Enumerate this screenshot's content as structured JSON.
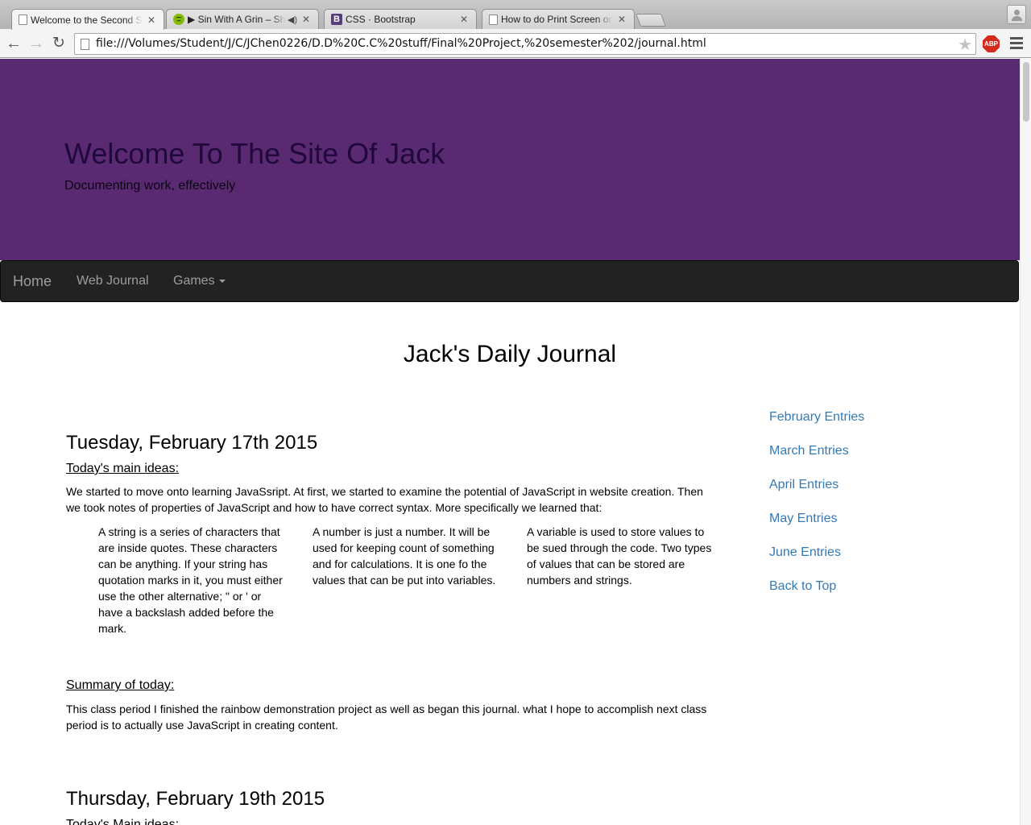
{
  "browser": {
    "tabs": [
      {
        "title": "Welcome to the Second Semester",
        "icon": "page-icon",
        "active": true
      },
      {
        "title": "▶ Sin With A Grin – Shinedown",
        "icon": "spotify-icon",
        "audio": true
      },
      {
        "title": "CSS · Bootstrap",
        "icon": "bootstrap-icon"
      },
      {
        "title": "How to do Print Screen on a Mac",
        "icon": "page-icon"
      }
    ],
    "url": "file:///Volumes/Student/J/C/JChen0226/D.D%20C.C%20stuff/Final%20Project,%20semester%202/journal.html",
    "extension_label": "ABP",
    "colors": {
      "chrome_bg": "#b4b4b4",
      "abp_red": "#d42a1b"
    }
  },
  "header": {
    "title": "Welcome To The Site Of Jack",
    "subtitle": "Documenting work, effectively",
    "bg_color": "#592a71"
  },
  "navbar": {
    "brand": "Home",
    "links": [
      "Web Journal",
      "Games"
    ],
    "bg_color": "#222222"
  },
  "main": {
    "title": "Jack's Daily Journal",
    "entries": [
      {
        "date": "Tuesday, February 17th 2015",
        "ideas_label": "Today's main ideas:",
        "intro": "We started to move onto learning JavaSsript. At first, we started to examine the potential of JavaScript in website creation. Then we took notes of properties of JavaScript and how to have correct syntax. More specifically we learned that:",
        "concepts": [
          "A string is a series of characters that are inside quotes. These characters can be anything. If your string has quotation marks in it, you must either use the other alternative; \" or ' or have a backslash added before the mark.",
          "A number is just a number. It will be used for keeping count of something and for calculations. It is one fo the values that can be put into variables.",
          "A variable is used to store values to be sued through the code. Two types of values that can be stored are numbers and strings."
        ],
        "summary_label": "Summary of today:",
        "summary": "This class period I finished the rainbow demonstration project as well as began this journal. what I hope to accomplish next class period is to actually use JavaScript in creating content."
      },
      {
        "date": "Thursday, February 19th 2015",
        "ideas_label": "Today's Main ideas:"
      }
    ]
  },
  "sidebar": {
    "links": [
      "February Entries",
      "March Entries",
      "April Entries",
      "May Entries",
      "June Entries",
      "Back to Top"
    ],
    "link_color": "#337ab7"
  }
}
